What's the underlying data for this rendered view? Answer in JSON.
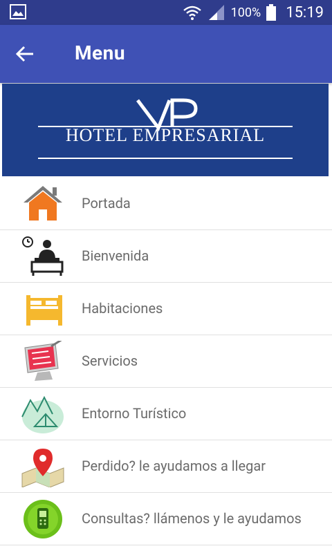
{
  "status_bar": {
    "battery": "100%",
    "time": "15:19"
  },
  "app_bar": {
    "title": "Menu"
  },
  "banner": {
    "logo_letters": "VP",
    "hotel_name": "HOTEL  EMPRESARIAL"
  },
  "menu": {
    "items": [
      {
        "label": "Portada",
        "icon": "home-icon"
      },
      {
        "label": "Bienvenida",
        "icon": "reception-icon"
      },
      {
        "label": "Habitaciones",
        "icon": "bed-icon"
      },
      {
        "label": "Servicios",
        "icon": "monitor-icon"
      },
      {
        "label": "Entorno Turístico",
        "icon": "mountain-tent-icon"
      },
      {
        "label": "Perdido? le ayudamos a llegar",
        "icon": "map-pin-icon"
      },
      {
        "label": "Consultas? llámenos y le ayudamos",
        "icon": "phone-icon"
      }
    ]
  }
}
